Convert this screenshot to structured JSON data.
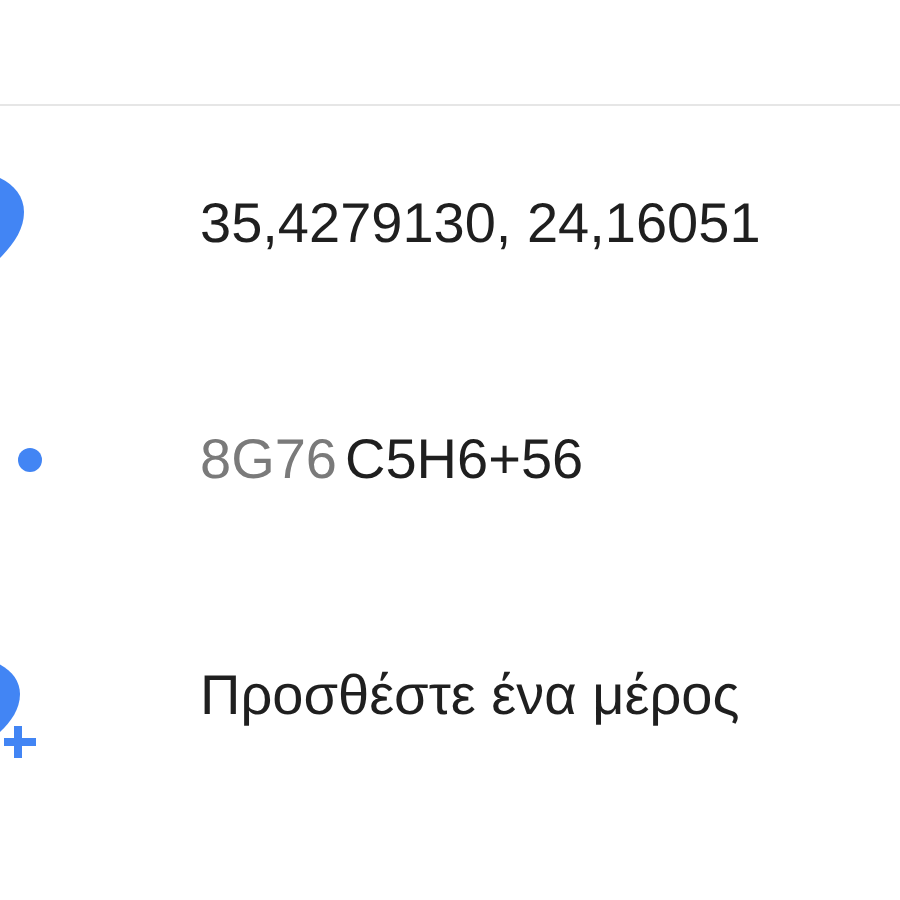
{
  "rows": [
    {
      "kind": "coords",
      "text": "35,4279130, 24,16051"
    },
    {
      "kind": "pluscode",
      "prefix": "8G76",
      "code": "C5H6+56"
    },
    {
      "kind": "add",
      "text": "Προσθέστε ένα μέρος"
    }
  ]
}
